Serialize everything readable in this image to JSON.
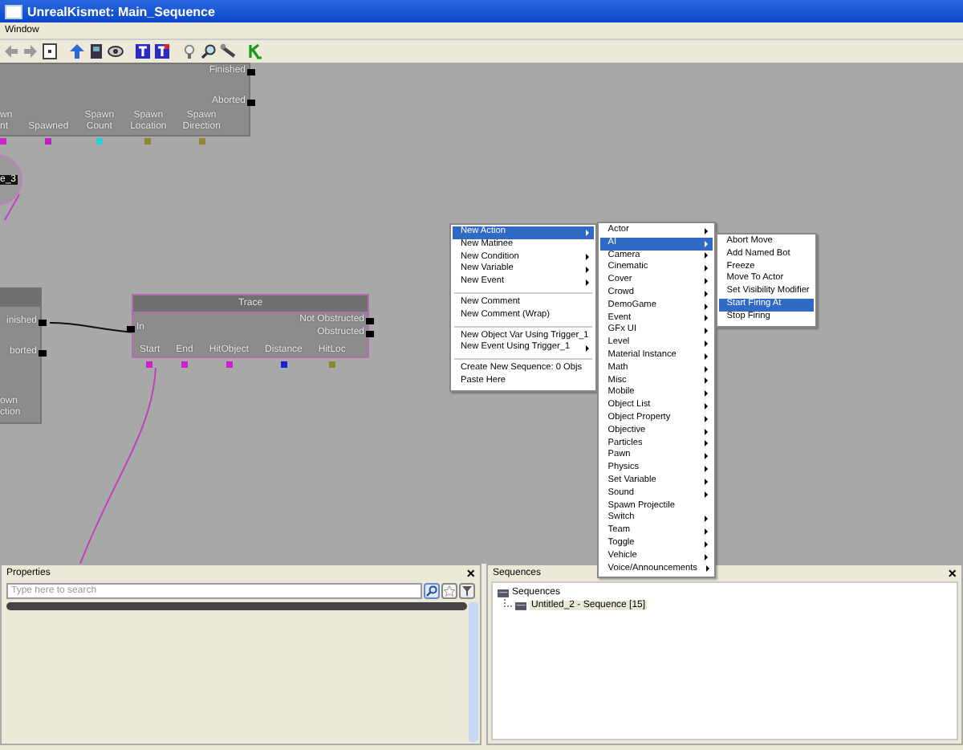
{
  "window": {
    "title": "UnrealKismet: Main_Sequence"
  },
  "menu_bar": [
    "Window"
  ],
  "canvas": {
    "spawn_node": {
      "outputs": [
        "Finished",
        "Aborted"
      ],
      "variables": [
        {
          "lines": [
            "wn",
            "nt"
          ],
          "color": "#d020d0"
        },
        {
          "lines": [
            "Spawned"
          ],
          "color": "#c020c0"
        },
        {
          "lines": [
            "Spawn",
            "Count"
          ],
          "color": "#30d0d0"
        },
        {
          "lines": [
            "Spawn",
            "Location"
          ],
          "color": "#8a8a30"
        },
        {
          "lines": [
            "Spawn",
            "Direction"
          ],
          "color": "#8a8a30"
        }
      ]
    },
    "var_node": {
      "label": "e_3"
    },
    "left_node": {
      "outputs": [
        "inished",
        "borted"
      ],
      "cut_label": [
        "own",
        "ction"
      ]
    },
    "trace_node": {
      "title": "Trace",
      "inputs": [
        "In"
      ],
      "outputs": [
        "Not Obstructed",
        "Obstructed"
      ],
      "variables": [
        {
          "label": "Start",
          "color": "#d020d0"
        },
        {
          "label": "End",
          "color": "#d020d0"
        },
        {
          "label": "HitObject",
          "color": "#d020d0"
        },
        {
          "label": "Distance",
          "color": "#2020d0"
        },
        {
          "label": "HitLoc",
          "color": "#8a8a30"
        }
      ]
    }
  },
  "context_menu": {
    "groups": [
      [
        {
          "label": "New Action",
          "submenu": true,
          "selected": true
        },
        {
          "label": "New Matinee",
          "submenu": false,
          "selected": false
        },
        {
          "label": "New Condition",
          "submenu": true,
          "selected": false
        },
        {
          "label": "New Variable",
          "submenu": true,
          "selected": false
        },
        {
          "label": "New Event",
          "submenu": true,
          "selected": false
        }
      ],
      [
        {
          "label": "New Comment",
          "submenu": false,
          "selected": false
        },
        {
          "label": "New Comment (Wrap)",
          "submenu": false,
          "selected": false
        }
      ],
      [
        {
          "label": "New Object Var Using Trigger_1",
          "submenu": false,
          "selected": false
        },
        {
          "label": "New Event Using Trigger_1",
          "submenu": true,
          "selected": false
        }
      ],
      [
        {
          "label": "Create New Sequence: 0 Objs",
          "submenu": false,
          "selected": false
        },
        {
          "label": "Paste Here",
          "submenu": false,
          "selected": false
        }
      ]
    ]
  },
  "action_submenu": [
    {
      "label": "Actor",
      "submenu": true,
      "selected": false
    },
    {
      "label": "AI",
      "submenu": true,
      "selected": true
    },
    {
      "label": "Camera",
      "submenu": true,
      "selected": false
    },
    {
      "label": "Cinematic",
      "submenu": true,
      "selected": false
    },
    {
      "label": "Cover",
      "submenu": true,
      "selected": false
    },
    {
      "label": "Crowd",
      "submenu": true,
      "selected": false
    },
    {
      "label": "DemoGame",
      "submenu": true,
      "selected": false
    },
    {
      "label": "Event",
      "submenu": true,
      "selected": false
    },
    {
      "label": "GFx UI",
      "submenu": true,
      "selected": false
    },
    {
      "label": "Level",
      "submenu": true,
      "selected": false
    },
    {
      "label": "Material Instance",
      "submenu": true,
      "selected": false
    },
    {
      "label": "Math",
      "submenu": true,
      "selected": false
    },
    {
      "label": "Misc",
      "submenu": true,
      "selected": false
    },
    {
      "label": "Mobile",
      "submenu": true,
      "selected": false
    },
    {
      "label": "Object List",
      "submenu": true,
      "selected": false
    },
    {
      "label": "Object Property",
      "submenu": true,
      "selected": false
    },
    {
      "label": "Objective",
      "submenu": true,
      "selected": false
    },
    {
      "label": "Particles",
      "submenu": true,
      "selected": false
    },
    {
      "label": "Pawn",
      "submenu": true,
      "selected": false
    },
    {
      "label": "Physics",
      "submenu": true,
      "selected": false
    },
    {
      "label": "Set Variable",
      "submenu": true,
      "selected": false
    },
    {
      "label": "Sound",
      "submenu": true,
      "selected": false
    },
    {
      "label": "Spawn Projectile",
      "submenu": false,
      "selected": false
    },
    {
      "label": "Switch",
      "submenu": true,
      "selected": false
    },
    {
      "label": "Team",
      "submenu": true,
      "selected": false
    },
    {
      "label": "Toggle",
      "submenu": true,
      "selected": false
    },
    {
      "label": "Vehicle",
      "submenu": true,
      "selected": false
    },
    {
      "label": "Voice/Announcements",
      "submenu": true,
      "selected": false
    }
  ],
  "ai_submenu": [
    {
      "label": "Abort Move",
      "selected": false
    },
    {
      "label": "Add Named Bot",
      "selected": false
    },
    {
      "label": "Freeze",
      "selected": false
    },
    {
      "label": "Move To Actor",
      "selected": false
    },
    {
      "label": "Set Visibility Modifier",
      "selected": false
    },
    {
      "label": "Start Firing At",
      "selected": true
    },
    {
      "label": "Stop Firing",
      "selected": false
    }
  ],
  "properties": {
    "title": "Properties",
    "close": "×",
    "search": {
      "placeholder": "Type here to search"
    }
  },
  "sequences": {
    "title": "Sequences",
    "close": "×",
    "tree": [
      {
        "label": "Sequences",
        "children": [
          {
            "label": "Untitled_2 - Sequence [15]"
          }
        ]
      }
    ]
  }
}
